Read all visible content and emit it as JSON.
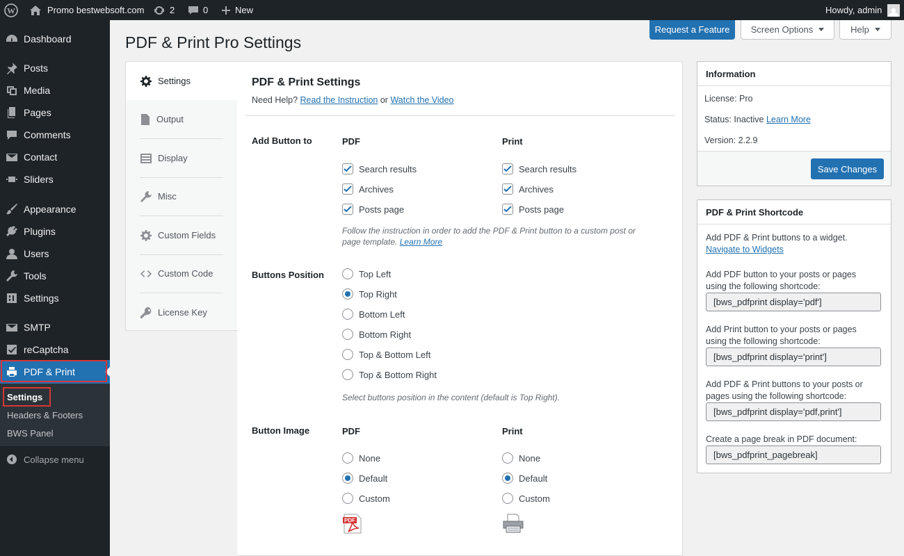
{
  "admin_bar": {
    "site_name": "Promo bestwebsoft.com",
    "updates_count": "2",
    "comments_count": "0",
    "new_label": "New",
    "howdy": "Howdy, admin"
  },
  "sidebar": {
    "items": [
      {
        "label": "Dashboard",
        "icon": "dashboard-icon"
      },
      {
        "label": "Posts",
        "icon": "pin-icon"
      },
      {
        "label": "Media",
        "icon": "media-icon"
      },
      {
        "label": "Pages",
        "icon": "pages-icon"
      },
      {
        "label": "Comments",
        "icon": "comment-icon"
      },
      {
        "label": "Contact",
        "icon": "mail-icon"
      },
      {
        "label": "Sliders",
        "icon": "slider-icon"
      },
      {
        "label": "Appearance",
        "icon": "brush-icon"
      },
      {
        "label": "Plugins",
        "icon": "plugin-icon"
      },
      {
        "label": "Users",
        "icon": "user-icon"
      },
      {
        "label": "Tools",
        "icon": "wrench-icon"
      },
      {
        "label": "Settings",
        "icon": "settings-icon"
      },
      {
        "label": "SMTP",
        "icon": "smtp-icon"
      },
      {
        "label": "reCaptcha",
        "icon": "check-icon"
      },
      {
        "label": "PDF & Print",
        "icon": "printer-icon"
      }
    ],
    "submenu": [
      "Settings",
      "Headers & Footers",
      "BWS Panel"
    ],
    "collapse": "Collapse menu"
  },
  "header": {
    "title": "PDF & Print Pro Settings",
    "request_feature": "Request a Feature",
    "screen_options": "Screen Options",
    "help": "Help"
  },
  "tabs": [
    "Settings",
    "Output",
    "Display",
    "Misc",
    "Custom Fields",
    "Custom Code",
    "License Key"
  ],
  "main": {
    "title": "PDF & Print Settings",
    "need_help": "Need Help?",
    "read_instruction": "Read the Instruction",
    "or": "or",
    "watch_video": "Watch the Video",
    "add_button": {
      "label": "Add Button to",
      "col_pdf": "PDF",
      "col_print": "Print",
      "options": [
        "Search results",
        "Archives",
        "Posts page"
      ],
      "hint": "Follow the instruction in order to add the PDF & Print button to a custom post or",
      "hint2": "page template.",
      "learn_more": "Learn More"
    },
    "position": {
      "label": "Buttons Position",
      "options": [
        "Top Left",
        "Top Right",
        "Bottom Left",
        "Bottom Right",
        "Top & Bottom Left",
        "Top & Bottom Right"
      ],
      "selected": "Top Right",
      "hint": "Select buttons position in the content (default is Top Right)."
    },
    "button_image": {
      "label": "Button Image",
      "col_pdf": "PDF",
      "col_print": "Print",
      "options": [
        "None",
        "Default",
        "Custom"
      ],
      "selected": "Default"
    }
  },
  "info_box": {
    "title": "Information",
    "license_label": "License:",
    "license_value": "Pro",
    "status_label": "Status:",
    "status_value": "Inactive",
    "learn_more": "Learn More",
    "version_label": "Version:",
    "version_value": "2.2.9",
    "save": "Save Changes"
  },
  "shortcode_box": {
    "title": "PDF & Print Shortcode",
    "widget_text": "Add PDF & Print buttons to a widget.",
    "widget_link": "Navigate to Widgets",
    "pdf_text1": "Add PDF button to your posts or pages",
    "pdf_text2": "using the following shortcode:",
    "pdf_code": "[bws_pdfprint display='pdf']",
    "print_text1": "Add Print button to your posts or pages",
    "print_text2": "using the following shortcode:",
    "print_code": "[bws_pdfprint display='print']",
    "both_text1": "Add PDF & Print buttons to your posts or",
    "both_text2": "pages using the following shortcode:",
    "both_code": "[bws_pdfprint display='pdf,print']",
    "break_text": "Create a page break in PDF document:",
    "break_code": "[bws_pdfprint_pagebreak]"
  },
  "colors": {
    "accent": "#2271b1",
    "highlight_border": "#d63638",
    "adminbar": "#1d2327"
  }
}
